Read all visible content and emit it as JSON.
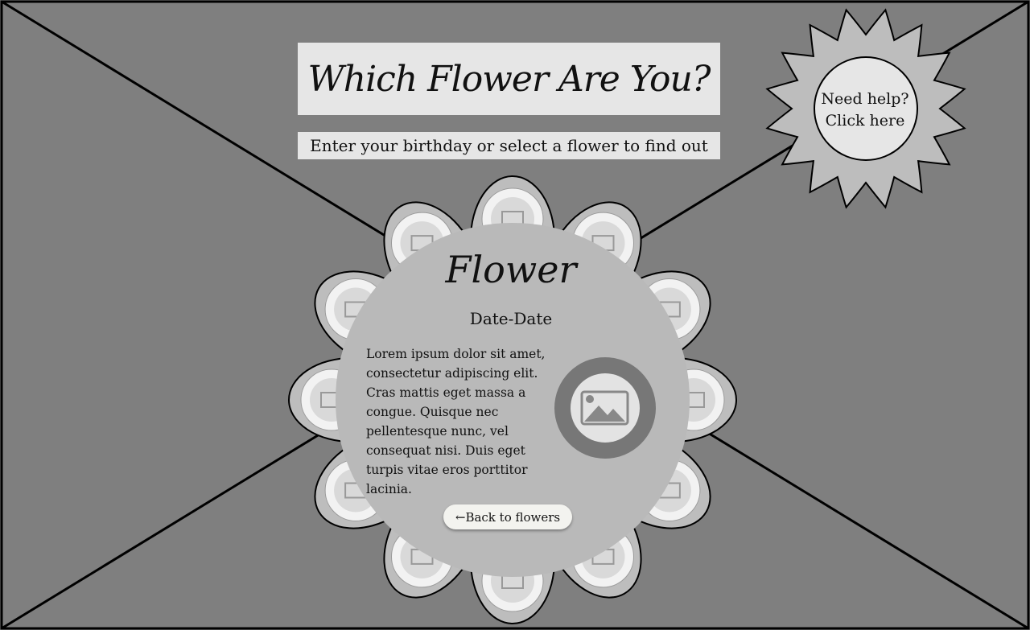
{
  "header": {
    "title": "Which Flower Are You?",
    "subtitle": "Enter your birthday or select a flower to find out"
  },
  "help": {
    "line1": "Need help?",
    "line2": "Click here"
  },
  "card": {
    "title": "Flower",
    "dates": "Date-Date",
    "description": "Lorem ipsum dolor sit amet, consectetur adipiscing elit. Cras mattis eget massa a congue. Quisque nec pellentesque nunc, vel consequat nisi. Duis eget turpis vitae eros porttitor lacinia.",
    "back_label": "←Back to flowers",
    "image_icon": "image-placeholder-icon"
  },
  "petals": {
    "count": 12,
    "image_icon": "image-placeholder-icon"
  },
  "colors": {
    "background": "#7f7f7f",
    "petal": "#bdbdbd",
    "card": "#b9b9b9",
    "label_box": "#e6e6e6",
    "button": "#f3f3ef"
  }
}
